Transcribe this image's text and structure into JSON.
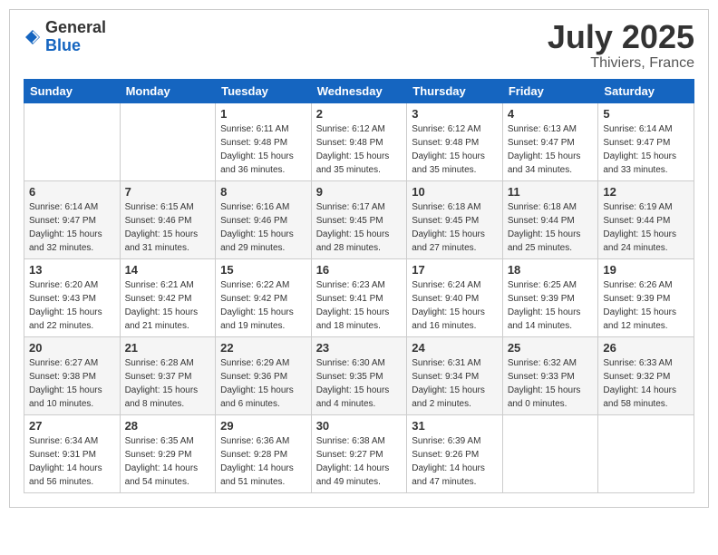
{
  "logo": {
    "general": "General",
    "blue": "Blue"
  },
  "title": {
    "month_year": "July 2025",
    "location": "Thiviers, France"
  },
  "weekdays": [
    "Sunday",
    "Monday",
    "Tuesday",
    "Wednesday",
    "Thursday",
    "Friday",
    "Saturday"
  ],
  "weeks": [
    [
      {
        "day": "",
        "sunrise": "",
        "sunset": "",
        "daylight": ""
      },
      {
        "day": "",
        "sunrise": "",
        "sunset": "",
        "daylight": ""
      },
      {
        "day": "1",
        "sunrise": "Sunrise: 6:11 AM",
        "sunset": "Sunset: 9:48 PM",
        "daylight": "Daylight: 15 hours and 36 minutes."
      },
      {
        "day": "2",
        "sunrise": "Sunrise: 6:12 AM",
        "sunset": "Sunset: 9:48 PM",
        "daylight": "Daylight: 15 hours and 35 minutes."
      },
      {
        "day": "3",
        "sunrise": "Sunrise: 6:12 AM",
        "sunset": "Sunset: 9:48 PM",
        "daylight": "Daylight: 15 hours and 35 minutes."
      },
      {
        "day": "4",
        "sunrise": "Sunrise: 6:13 AM",
        "sunset": "Sunset: 9:47 PM",
        "daylight": "Daylight: 15 hours and 34 minutes."
      },
      {
        "day": "5",
        "sunrise": "Sunrise: 6:14 AM",
        "sunset": "Sunset: 9:47 PM",
        "daylight": "Daylight: 15 hours and 33 minutes."
      }
    ],
    [
      {
        "day": "6",
        "sunrise": "Sunrise: 6:14 AM",
        "sunset": "Sunset: 9:47 PM",
        "daylight": "Daylight: 15 hours and 32 minutes."
      },
      {
        "day": "7",
        "sunrise": "Sunrise: 6:15 AM",
        "sunset": "Sunset: 9:46 PM",
        "daylight": "Daylight: 15 hours and 31 minutes."
      },
      {
        "day": "8",
        "sunrise": "Sunrise: 6:16 AM",
        "sunset": "Sunset: 9:46 PM",
        "daylight": "Daylight: 15 hours and 29 minutes."
      },
      {
        "day": "9",
        "sunrise": "Sunrise: 6:17 AM",
        "sunset": "Sunset: 9:45 PM",
        "daylight": "Daylight: 15 hours and 28 minutes."
      },
      {
        "day": "10",
        "sunrise": "Sunrise: 6:18 AM",
        "sunset": "Sunset: 9:45 PM",
        "daylight": "Daylight: 15 hours and 27 minutes."
      },
      {
        "day": "11",
        "sunrise": "Sunrise: 6:18 AM",
        "sunset": "Sunset: 9:44 PM",
        "daylight": "Daylight: 15 hours and 25 minutes."
      },
      {
        "day": "12",
        "sunrise": "Sunrise: 6:19 AM",
        "sunset": "Sunset: 9:44 PM",
        "daylight": "Daylight: 15 hours and 24 minutes."
      }
    ],
    [
      {
        "day": "13",
        "sunrise": "Sunrise: 6:20 AM",
        "sunset": "Sunset: 9:43 PM",
        "daylight": "Daylight: 15 hours and 22 minutes."
      },
      {
        "day": "14",
        "sunrise": "Sunrise: 6:21 AM",
        "sunset": "Sunset: 9:42 PM",
        "daylight": "Daylight: 15 hours and 21 minutes."
      },
      {
        "day": "15",
        "sunrise": "Sunrise: 6:22 AM",
        "sunset": "Sunset: 9:42 PM",
        "daylight": "Daylight: 15 hours and 19 minutes."
      },
      {
        "day": "16",
        "sunrise": "Sunrise: 6:23 AM",
        "sunset": "Sunset: 9:41 PM",
        "daylight": "Daylight: 15 hours and 18 minutes."
      },
      {
        "day": "17",
        "sunrise": "Sunrise: 6:24 AM",
        "sunset": "Sunset: 9:40 PM",
        "daylight": "Daylight: 15 hours and 16 minutes."
      },
      {
        "day": "18",
        "sunrise": "Sunrise: 6:25 AM",
        "sunset": "Sunset: 9:39 PM",
        "daylight": "Daylight: 15 hours and 14 minutes."
      },
      {
        "day": "19",
        "sunrise": "Sunrise: 6:26 AM",
        "sunset": "Sunset: 9:39 PM",
        "daylight": "Daylight: 15 hours and 12 minutes."
      }
    ],
    [
      {
        "day": "20",
        "sunrise": "Sunrise: 6:27 AM",
        "sunset": "Sunset: 9:38 PM",
        "daylight": "Daylight: 15 hours and 10 minutes."
      },
      {
        "day": "21",
        "sunrise": "Sunrise: 6:28 AM",
        "sunset": "Sunset: 9:37 PM",
        "daylight": "Daylight: 15 hours and 8 minutes."
      },
      {
        "day": "22",
        "sunrise": "Sunrise: 6:29 AM",
        "sunset": "Sunset: 9:36 PM",
        "daylight": "Daylight: 15 hours and 6 minutes."
      },
      {
        "day": "23",
        "sunrise": "Sunrise: 6:30 AM",
        "sunset": "Sunset: 9:35 PM",
        "daylight": "Daylight: 15 hours and 4 minutes."
      },
      {
        "day": "24",
        "sunrise": "Sunrise: 6:31 AM",
        "sunset": "Sunset: 9:34 PM",
        "daylight": "Daylight: 15 hours and 2 minutes."
      },
      {
        "day": "25",
        "sunrise": "Sunrise: 6:32 AM",
        "sunset": "Sunset: 9:33 PM",
        "daylight": "Daylight: 15 hours and 0 minutes."
      },
      {
        "day": "26",
        "sunrise": "Sunrise: 6:33 AM",
        "sunset": "Sunset: 9:32 PM",
        "daylight": "Daylight: 14 hours and 58 minutes."
      }
    ],
    [
      {
        "day": "27",
        "sunrise": "Sunrise: 6:34 AM",
        "sunset": "Sunset: 9:31 PM",
        "daylight": "Daylight: 14 hours and 56 minutes."
      },
      {
        "day": "28",
        "sunrise": "Sunrise: 6:35 AM",
        "sunset": "Sunset: 9:29 PM",
        "daylight": "Daylight: 14 hours and 54 minutes."
      },
      {
        "day": "29",
        "sunrise": "Sunrise: 6:36 AM",
        "sunset": "Sunset: 9:28 PM",
        "daylight": "Daylight: 14 hours and 51 minutes."
      },
      {
        "day": "30",
        "sunrise": "Sunrise: 6:38 AM",
        "sunset": "Sunset: 9:27 PM",
        "daylight": "Daylight: 14 hours and 49 minutes."
      },
      {
        "day": "31",
        "sunrise": "Sunrise: 6:39 AM",
        "sunset": "Sunset: 9:26 PM",
        "daylight": "Daylight: 14 hours and 47 minutes."
      },
      {
        "day": "",
        "sunrise": "",
        "sunset": "",
        "daylight": ""
      },
      {
        "day": "",
        "sunrise": "",
        "sunset": "",
        "daylight": ""
      }
    ]
  ]
}
